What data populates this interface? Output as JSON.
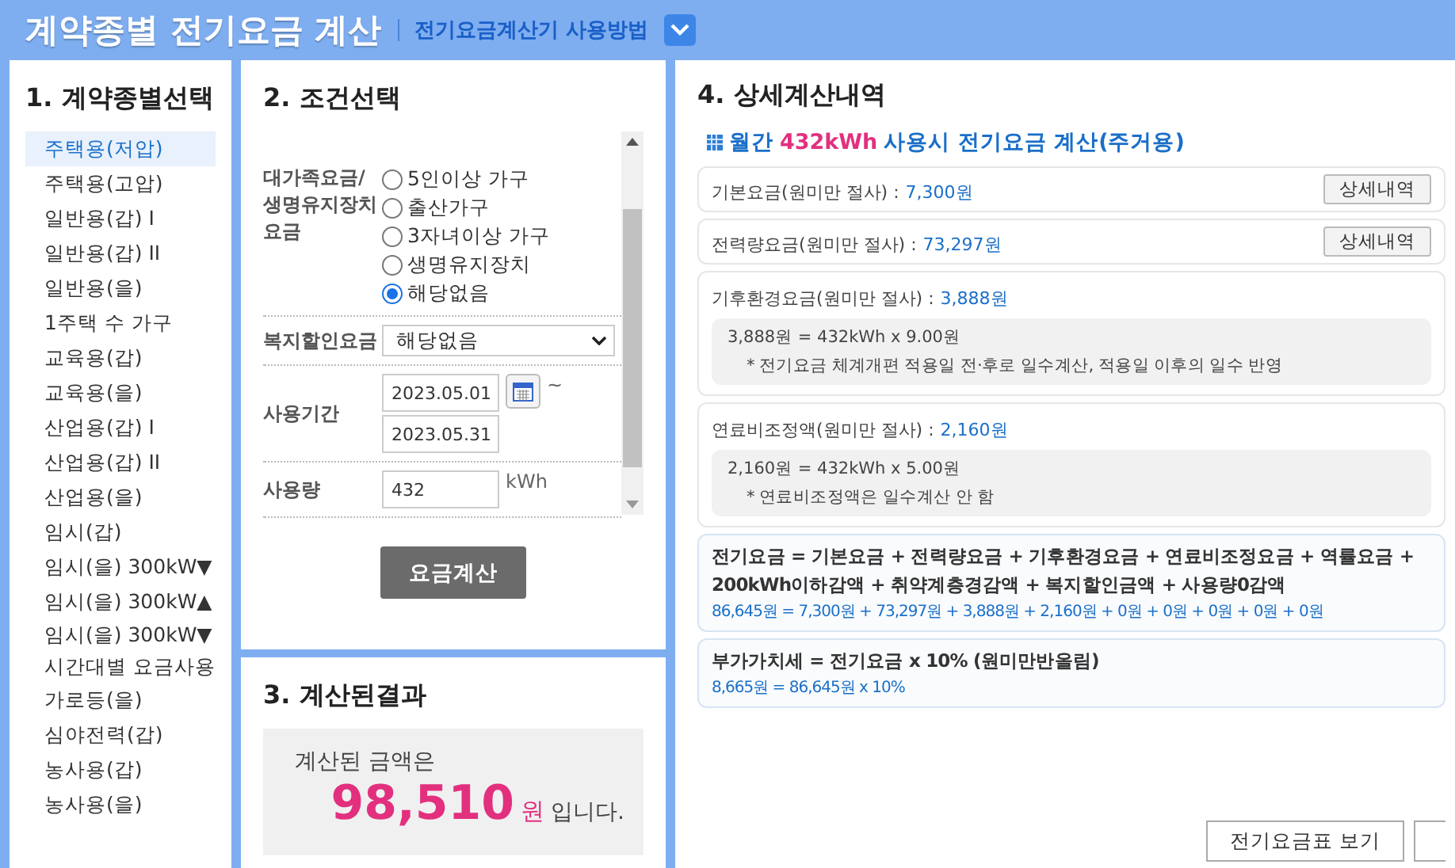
{
  "header": {
    "title": "계약종별 전기요금 계산",
    "link": "전기요금계산기 사용방법"
  },
  "contract_panel": {
    "heading": "1. 계약종별선택",
    "items": [
      {
        "label": "주택용(저압)",
        "selected": true
      },
      {
        "label": "주택용(고압)",
        "selected": false
      },
      {
        "label": "일반용(갑) I",
        "selected": false
      },
      {
        "label": "일반용(갑) II",
        "selected": false
      },
      {
        "label": "일반용(을)",
        "selected": false
      },
      {
        "label": "1주택 수 가구",
        "selected": false
      },
      {
        "label": "교육용(갑)",
        "selected": false
      },
      {
        "label": "교육용(을)",
        "selected": false
      },
      {
        "label": "산업용(갑) I",
        "selected": false
      },
      {
        "label": "산업용(갑) II",
        "selected": false
      },
      {
        "label": "산업용(을)",
        "selected": false
      },
      {
        "label": "임시(갑)",
        "selected": false
      },
      {
        "label": "임시(을) 300kW▼",
        "selected": false
      },
      {
        "label": "임시(을) 300kW▲",
        "selected": false
      },
      {
        "label": "임시(을) 300kW▼ 시간대별 요금사용",
        "selected": false
      },
      {
        "label": "가로등(을)",
        "selected": false
      },
      {
        "label": "심야전력(갑)",
        "selected": false
      },
      {
        "label": "농사용(갑)",
        "selected": false
      },
      {
        "label": "농사용(을)",
        "selected": false
      }
    ]
  },
  "conditions_panel": {
    "heading": "2. 조건선택",
    "family": {
      "label": "대가족요금/ 생명유지장치 요금",
      "options": [
        {
          "label": "5인이상 가구",
          "selected": false
        },
        {
          "label": "출산가구",
          "selected": false
        },
        {
          "label": "3자녀이상 가구",
          "selected": false
        },
        {
          "label": "생명유지장치",
          "selected": false
        },
        {
          "label": "해당없음",
          "selected": true
        }
      ]
    },
    "welfare": {
      "label": "복지할인요금",
      "value": "해당없음"
    },
    "period": {
      "label": "사용기간",
      "start": "2023.05.01",
      "separator": "~",
      "end": "2023.05.31"
    },
    "usage": {
      "label": "사용량",
      "value": "432",
      "unit": "kWh"
    },
    "button": "요금계산"
  },
  "result_panel": {
    "heading": "3. 계산된결과",
    "prefix": "계산된 금액은",
    "amount": "98,510",
    "unit": "원",
    "suffix": "입니다."
  },
  "detail_panel": {
    "heading": "4. 상세계산내역",
    "subtitle_before": "월간",
    "subtitle_highlight": "432kWh",
    "subtitle_after": "사용시 전기요금 계산(주거용)",
    "items": [
      {
        "kind": "simple",
        "label": "기본요금(원미만 절사) :",
        "value": "7,300원",
        "button": "상세내역"
      },
      {
        "kind": "simple",
        "label": "전력량요금(원미만 절사) :",
        "value": "73,297원",
        "button": "상세내역"
      },
      {
        "kind": "note",
        "label": "기후환경요금(원미만 절사) :",
        "value": "3,888원",
        "formula": "3,888원 = 432kWh x 9.00원",
        "note": "* 전기요금 체계개편 적용일 전·후로 일수계산, 적용일 이후의 일수 반영"
      },
      {
        "kind": "note",
        "label": "연료비조정액(원미만 절사) :",
        "value": "2,160원",
        "formula": "2,160원 = 432kWh x 5.00원",
        "note": "* 연료비조정액은 일수계산 안 함"
      },
      {
        "kind": "formula",
        "title": "전기요금 = 기본요금 + 전력량요금 + 기후환경요금 + 연료비조정요금 + 역률요금 + 200kWh이하감액 + 취약계층경감액 + 복지할인금액 + 사용량0감액",
        "formula": "86,645원 = 7,300원 + 73,297원 + 3,888원 + 2,160원 + 0원 + 0원 + 0원 + 0원 + 0원"
      },
      {
        "kind": "formula",
        "title": "부가가치세 = 전기요금 x 10% (원미만반올림)",
        "formula": "8,665원 = 86,645원 x 10%"
      }
    ],
    "buttons": [
      "전기요금표 보기"
    ]
  }
}
